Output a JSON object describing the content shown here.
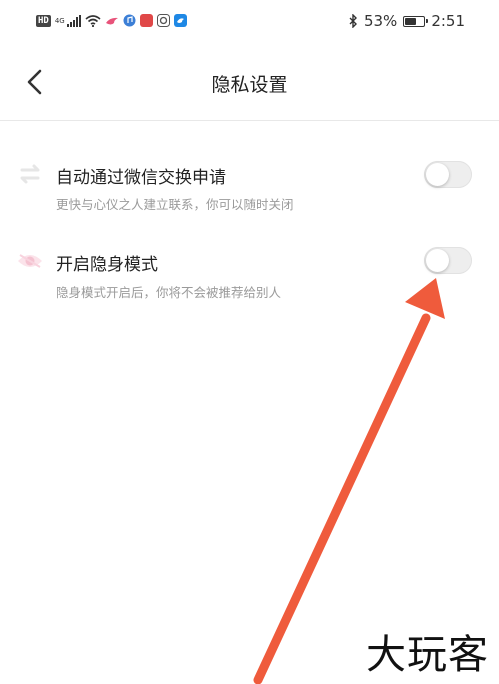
{
  "status_bar": {
    "hd": "HD",
    "network": "4G",
    "battery": "53%",
    "battery_level": 0.53,
    "time": "2:51"
  },
  "header": {
    "title": "隐私设置",
    "back_icon": "chevron-left-icon"
  },
  "settings": [
    {
      "icon": "swap-arrows-icon",
      "title": "自动通过微信交换申请",
      "description": "更快与心仪之人建立联系，你可以随时关闭",
      "enabled": false
    },
    {
      "icon": "eye-hidden-icon",
      "title": "开启隐身模式",
      "description": "隐身模式开启后，你将不会被推荐给别人",
      "enabled": false
    }
  ],
  "annotation": {
    "arrow_color": "#ef5b3c"
  },
  "watermark": "大玩客"
}
